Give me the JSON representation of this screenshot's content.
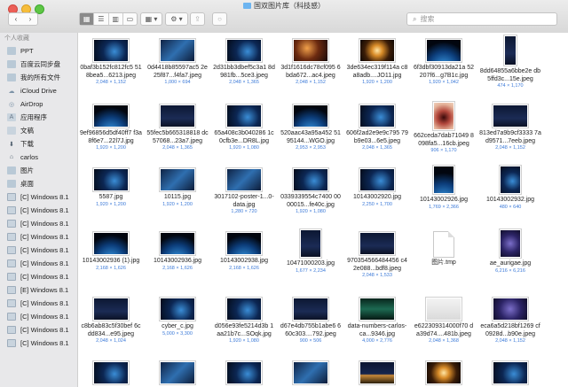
{
  "window": {
    "title": "国双图片库（科技感）"
  },
  "toolbar": {
    "back": "‹",
    "forward": "›",
    "view_icon": "▦",
    "list_icon": "☰",
    "column_icon": "▥",
    "gallery_icon": "▭",
    "arrange_label": "▦ ▾",
    "action_label": "⚙ ▾",
    "share_label": "⇪",
    "tag_label": "○"
  },
  "search": {
    "placeholder": "搜索"
  },
  "sidebar": {
    "header": "个人收藏",
    "items": [
      {
        "label": "PPT",
        "icon": "folder-icon"
      },
      {
        "label": "百度云同步盘",
        "icon": "folder-icon"
      },
      {
        "label": "我的所有文件",
        "icon": "folder-icon"
      },
      {
        "label": "iCloud Drive",
        "icon": "cloud-icon"
      },
      {
        "label": "AirDrop",
        "icon": "airdrop-icon"
      },
      {
        "label": "应用程序",
        "icon": "apps-icon"
      },
      {
        "label": "文稿",
        "icon": "document-icon"
      },
      {
        "label": "下载",
        "icon": "download-icon"
      },
      {
        "label": "carlos",
        "icon": "home-icon"
      },
      {
        "label": "图片",
        "icon": "folder-icon"
      },
      {
        "label": "桌面",
        "icon": "folder-icon"
      },
      {
        "label": "[C] Windows 8.1",
        "icon": "disk-icon"
      },
      {
        "label": "[C] Windows 8.1",
        "icon": "disk-icon"
      },
      {
        "label": "[C] Windows 8.1",
        "icon": "disk-icon"
      },
      {
        "label": "[C] Windows 8.1",
        "icon": "disk-icon"
      },
      {
        "label": "[C] Windows 8.1",
        "icon": "disk-icon"
      },
      {
        "label": "[C] Windows 8.1",
        "icon": "disk-icon"
      },
      {
        "label": "[C] Windows 8.1",
        "icon": "disk-icon"
      },
      {
        "label": "[E] Windows 8.1",
        "icon": "disk-icon"
      },
      {
        "label": "[C] Windows 8.1",
        "icon": "disk-icon"
      },
      {
        "label": "[C] Windows 8.1",
        "icon": "disk-icon"
      },
      {
        "label": "[C] Windows 8.1",
        "icon": "disk-icon"
      },
      {
        "label": "[C] Windows 8.1",
        "icon": "disk-icon"
      }
    ]
  },
  "files": [
    {
      "name": "0baf3b152fc812fc5 518bea5...6213.jpeg",
      "meta": "2,048 × 1,152",
      "style": "t-blue"
    },
    {
      "name": "0d4418b85597ac5 2e25f87...f4fa7.jpeg",
      "meta": "1,000 × 694",
      "style": "t-tech"
    },
    {
      "name": "2d31bb3dbef5c3a1 8d981fb...5ce3.jpeg",
      "meta": "2,048 × 1,365",
      "style": "t-blue"
    },
    {
      "name": "3d1f1616dc78cf095 6bda672...ac4.jpeg",
      "meta": "2,048 × 1,152",
      "style": "t-orange"
    },
    {
      "name": "3de634ec319f114a c8a8adb....JO11.jpg",
      "meta": "1,920 × 1,200",
      "style": "t-glow"
    },
    {
      "name": "6f3dbf30913da21a 52207f6...g7B1c.jpg",
      "meta": "1,920 × 1,042",
      "style": "t-earth"
    },
    {
      "name": "8dd64855a6bbe2e db5ffd3c...15e.jpeg",
      "meta": "474 × 1,170",
      "style": "t-night"
    },
    {
      "name": "9ef96856d5df40ff7 f3a8f6e7...22l7J.jpg",
      "meta": "1,920 × 1,200",
      "style": "t-earth"
    },
    {
      "name": "55fec5b665318818 dc57068...23a7.jpeg",
      "meta": "2,048 × 1,365",
      "style": "t-night"
    },
    {
      "name": "65a408c3b040286 1c0cfb3e...DR8L.jpg",
      "meta": "1,920 × 1,080",
      "style": "t-blue"
    },
    {
      "name": "520aac43a95a452 5195144...WGO.jpg",
      "meta": "2,953 × 2,953",
      "style": "t-earth"
    },
    {
      "name": "606f2ad2e9e9c795 79b9e03...6e5.jpeg",
      "meta": "2,048 × 1,365",
      "style": "t-blue"
    },
    {
      "name": "662ceda7dab71049 8098fa5...16cb.jpeg",
      "meta": "906 × 1,170",
      "style": "t-mouth"
    },
    {
      "name": "813ed7a9b9cf3333 7ad9571...7eeb.jpeg",
      "meta": "2,048 × 1,152",
      "style": "t-night"
    },
    {
      "name": "5587.jpg",
      "meta": "1,920 × 1,200",
      "style": "t-blue"
    },
    {
      "name": "10115.jpg",
      "meta": "1,920 × 1,200",
      "style": "t-tech"
    },
    {
      "name": "3017102-poster-1...0-data.jpg",
      "meta": "1,280 × 720",
      "style": "t-tech"
    },
    {
      "name": "0339339554c7400 0000015...fe40c.jpg",
      "meta": "1,920 × 1,080",
      "style": "t-blue"
    },
    {
      "name": "10143002920.jpg",
      "meta": "2,250 × 1,700",
      "style": "t-blue"
    },
    {
      "name": "10143002926.jpg",
      "meta": "1,769 × 2,366",
      "style": "t-earth"
    },
    {
      "name": "10143002932.jpg",
      "meta": "480 × 640",
      "style": "t-blue"
    },
    {
      "name": "10143002936 (1).jpg",
      "meta": "2,168 × 1,626",
      "style": "t-earth"
    },
    {
      "name": "10143002936.jpg",
      "meta": "2,168 × 1,626",
      "style": "t-earth"
    },
    {
      "name": "10143002938.jpg",
      "meta": "2,168 × 1,626",
      "style": "t-earth"
    },
    {
      "name": "10471000203.jpg",
      "meta": "1,677 × 2,234",
      "style": "t-night"
    },
    {
      "name": "970354566484456 c42e088...bdf8.jpeg",
      "meta": "2,048 × 1,533",
      "style": "t-night"
    },
    {
      "name": "图片.tmp",
      "meta": "",
      "style": "t-white"
    },
    {
      "name": "ae_aurigae.jpg",
      "meta": "6,216 × 6,216",
      "style": "t-purple"
    },
    {
      "name": "c8b6ab83c5f30bef 6cdd834...e95.jpeg",
      "meta": "2,048 × 1,024",
      "style": "t-night"
    },
    {
      "name": "cyber_c.jpg",
      "meta": "5,000 × 3,300",
      "style": "t-blue"
    },
    {
      "name": "d056e93fe5214d3b 1aa21b7c...SOqk.jpg",
      "meta": "1,920 × 1,080",
      "style": "t-blue"
    },
    {
      "name": "d67e4db755b1abe6 660c303....792.jpeg",
      "meta": "900 × 506",
      "style": "t-night"
    },
    {
      "name": "data-numbers-carlos-ca...9346.jpg",
      "meta": "4,000 × 2,776",
      "style": "t-green"
    },
    {
      "name": "e622309314000f70 da39d74....481b.jpeg",
      "meta": "2,048 × 1,368",
      "style": "t-hand"
    },
    {
      "name": "eca6a5d218bf1269 cf0928d...b90e.jpeg",
      "meta": "2,048 × 1,152",
      "style": "t-purple"
    },
    {
      "name": "",
      "meta": "",
      "style": "t-blue"
    },
    {
      "name": "",
      "meta": "",
      "style": "t-tech"
    },
    {
      "name": "",
      "meta": "",
      "style": "t-blue"
    },
    {
      "name": "",
      "meta": "",
      "style": "t-tech"
    },
    {
      "name": "",
      "meta": "",
      "style": "t-city"
    },
    {
      "name": "",
      "meta": "",
      "style": "t-glow"
    },
    {
      "name": "",
      "meta": "",
      "style": "t-blue"
    }
  ]
}
